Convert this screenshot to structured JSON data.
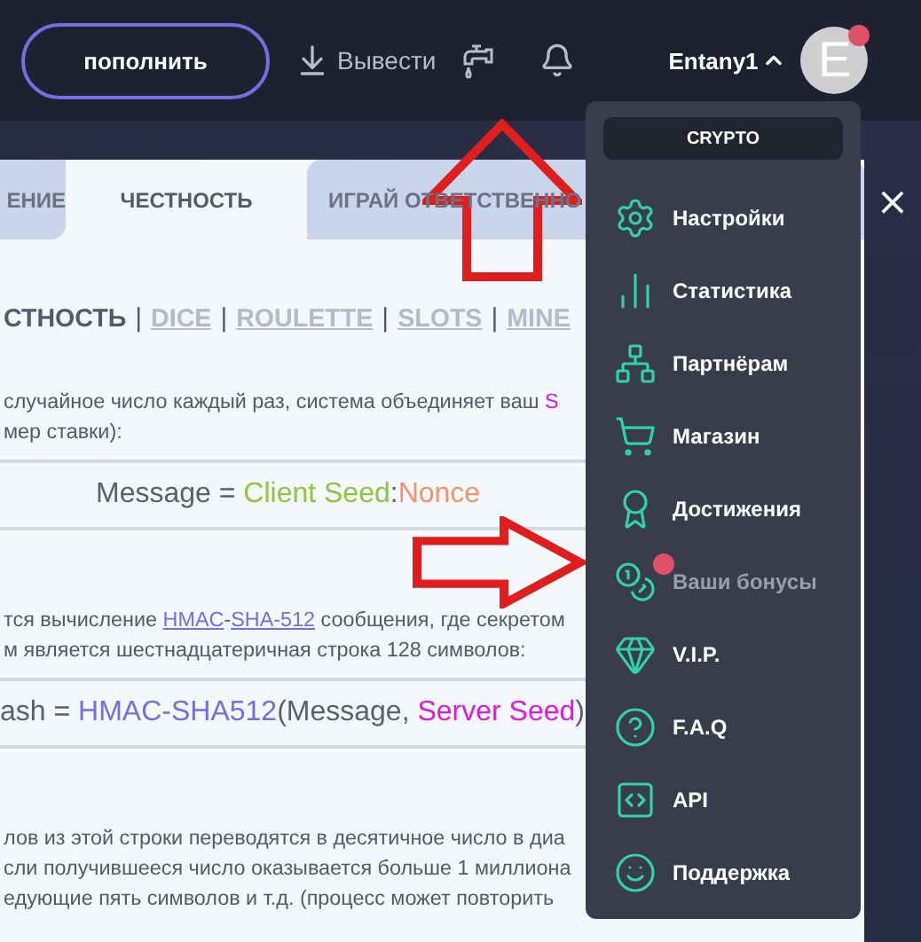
{
  "header": {
    "deposit_button": "пополнить",
    "withdraw_button": "Вывести",
    "username": "Entany1",
    "avatar_letter": "E",
    "avatar_badge": true
  },
  "tabs": [
    {
      "label": "ЕНИЕ",
      "selected": false
    },
    {
      "label": "ЧЕСТНОСТЬ",
      "selected": true
    },
    {
      "label": "ИГРАЙ ОТВЕТСТВЕННО",
      "selected": false
    }
  ],
  "game_nav": [
    {
      "kind": "link",
      "label": "СТНОСТЬ",
      "selected": true
    },
    {
      "kind": "separator",
      "label": "|"
    },
    {
      "kind": "link",
      "label": "DICE",
      "selected": false
    },
    {
      "kind": "separator",
      "label": "|"
    },
    {
      "kind": "link",
      "label": "ROULETTE",
      "selected": false
    },
    {
      "kind": "separator",
      "label": "|"
    },
    {
      "kind": "link",
      "label": "SLOTS",
      "selected": false
    },
    {
      "kind": "separator",
      "label": "|"
    },
    {
      "kind": "link",
      "label": "MINE",
      "selected": false
    }
  ],
  "blocks": [
    {
      "kind": "text",
      "lines": [
        [
          {
            "kind": "plain",
            "text": "случайное число каждый раз, система объединяет ваш "
          },
          {
            "kind": "server",
            "text": "S"
          }
        ],
        [
          {
            "kind": "plain",
            "text": "мер ставки):"
          }
        ]
      ]
    },
    {
      "kind": "formula",
      "parts": [
        {
          "kind": "plain",
          "text": "Message = "
        },
        {
          "kind": "seed",
          "text": "Client Seed"
        },
        {
          "kind": "plain",
          "text": ":"
        },
        {
          "kind": "nonce",
          "text": "Nonce"
        }
      ]
    },
    {
      "kind": "text",
      "lines": [
        [
          {
            "kind": "plain",
            "text": "тся вычисление "
          },
          {
            "kind": "link",
            "text": "HMAC"
          },
          {
            "kind": "plain",
            "text": "-"
          },
          {
            "kind": "link",
            "text": "SHA-512"
          },
          {
            "kind": "plain",
            "text": " сообщения, где секретом"
          }
        ],
        [
          {
            "kind": "plain",
            "text": "м является шестнадцатеричная строка 128 символов:"
          }
        ]
      ]
    },
    {
      "kind": "formula",
      "parts": [
        {
          "kind": "plain",
          "text": "ash = "
        },
        {
          "kind": "func",
          "text": "HMAC-SHA512"
        },
        {
          "kind": "plain",
          "text": "(Message, "
        },
        {
          "kind": "server",
          "text": "Server Seed"
        },
        {
          "kind": "plain",
          "text": ")"
        }
      ]
    },
    {
      "kind": "text",
      "lines": [
        [
          {
            "kind": "plain",
            "text": "лов из этой строки переводятся в десятичное число в диа"
          }
        ],
        [
          {
            "kind": "plain",
            "text": "сли получившееся число оказывается больше 1 миллиона"
          }
        ],
        [
          {
            "kind": "plain",
            "text": "едующие пять символов и т.д. (процесс может повторить"
          }
        ]
      ]
    }
  ],
  "menu": {
    "section": "CRYPTO",
    "items": [
      {
        "label": "Настройки",
        "disabled": false,
        "badge": false
      },
      {
        "label": "Статистика",
        "disabled": false,
        "badge": false
      },
      {
        "label": "Партнёрам",
        "disabled": false,
        "badge": false
      },
      {
        "label": "Магазин",
        "disabled": false,
        "badge": false
      },
      {
        "label": "Достижения",
        "disabled": false,
        "badge": false
      },
      {
        "label": "Ваши бонусы",
        "disabled": true,
        "badge": true
      },
      {
        "label": "V.I.P.",
        "disabled": false,
        "badge": false
      },
      {
        "label": "F.A.Q",
        "disabled": false,
        "badge": false
      },
      {
        "label": "API",
        "disabled": false,
        "badge": false
      },
      {
        "label": "Поддержка",
        "disabled": false,
        "badge": false
      }
    ]
  },
  "close_button": "×"
}
